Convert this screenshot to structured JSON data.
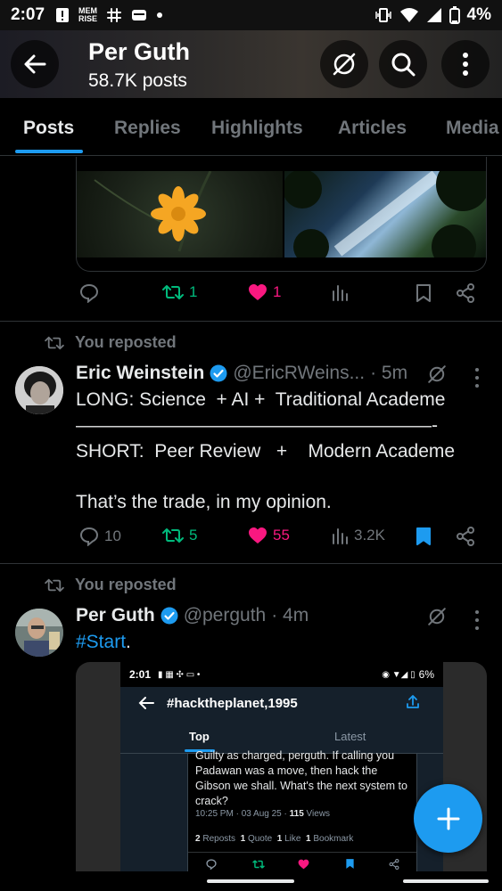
{
  "status_bar": {
    "time": "2:07",
    "icons": [
      "alert-icon",
      "memrise-icon",
      "slack-icon",
      "wallet-icon",
      "dot-icon"
    ],
    "memrise_label": "MEM\nRISE",
    "battery": "4%"
  },
  "header": {
    "title": "Per Guth",
    "subtitle": "58.7K posts"
  },
  "tabs": [
    {
      "label": "Posts"
    },
    {
      "label": "Replies"
    },
    {
      "label": "Highlights"
    },
    {
      "label": "Articles"
    },
    {
      "label": "Media"
    }
  ],
  "post1": {
    "retweets": "1",
    "likes": "1"
  },
  "post2": {
    "repost_label": "You reposted",
    "name": "Eric Weinstein",
    "handle": "@EricRWeins...",
    "time": "· 5m",
    "lines": [
      "LONG: Science  + AI +  Traditional Academe",
      "———————————————————-",
      "SHORT:  Peer Review   +    Modern Academe",
      "",
      "That’s the trade, in my opinion."
    ],
    "replies": "10",
    "retweets": "5",
    "likes": "55",
    "views": "3.2K"
  },
  "post3": {
    "repost_label": "You reposted",
    "name": "Per Guth",
    "handle": "@perguth",
    "time": "· 4m",
    "hashtag": "#Start",
    "period": "."
  },
  "embed": {
    "time": "2:01",
    "battery": "6%",
    "title": "#hacktheplanet,1995",
    "tab_top": "Top",
    "tab_latest": "Latest",
    "text": "Guilty as charged, perguth. If calling you Padawan was a  move, then hack the Gibson we shall. What's the next system to crack?",
    "time_date": "10:25 PM · 03 Aug 25 ·",
    "views_count": "115",
    "views_label": "Views",
    "reposts_count": "2",
    "reposts_label": "Reposts",
    "quote_count": "1",
    "quote_label": "Quote",
    "like_count": "1",
    "like_label": "Like",
    "bookmark_count": "1",
    "bookmark_label": "Bookmark"
  },
  "colors": {
    "accent": "#1d9bf0",
    "retweet": "#00ba7c",
    "like": "#f91880",
    "muted": "#71767b"
  }
}
